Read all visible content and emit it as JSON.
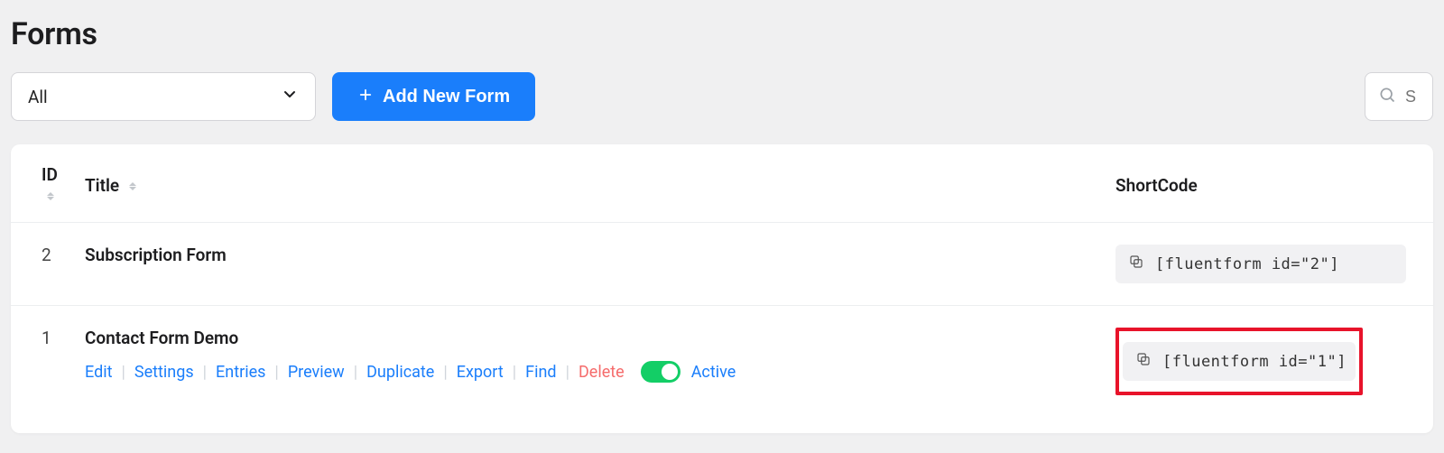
{
  "page_title": "Forms",
  "filter": {
    "selected_label": "All"
  },
  "add_button_label": "Add New Form",
  "search": {
    "placeholder": "S"
  },
  "columns": {
    "id": "ID",
    "title": "Title",
    "shortcode": "ShortCode"
  },
  "row_actions": {
    "edit": "Edit",
    "settings": "Settings",
    "entries": "Entries",
    "preview": "Preview",
    "duplicate": "Duplicate",
    "export": "Export",
    "find": "Find",
    "delete": "Delete"
  },
  "status": {
    "active_label": "Active"
  },
  "rows": [
    {
      "id": "2",
      "title": "Subscription Form",
      "shortcode": "[fluentform id=\"2\"]",
      "show_actions": false,
      "highlight_shortcode": false
    },
    {
      "id": "1",
      "title": "Contact Form Demo",
      "shortcode": "[fluentform id=\"1\"]",
      "show_actions": true,
      "highlight_shortcode": true
    }
  ]
}
